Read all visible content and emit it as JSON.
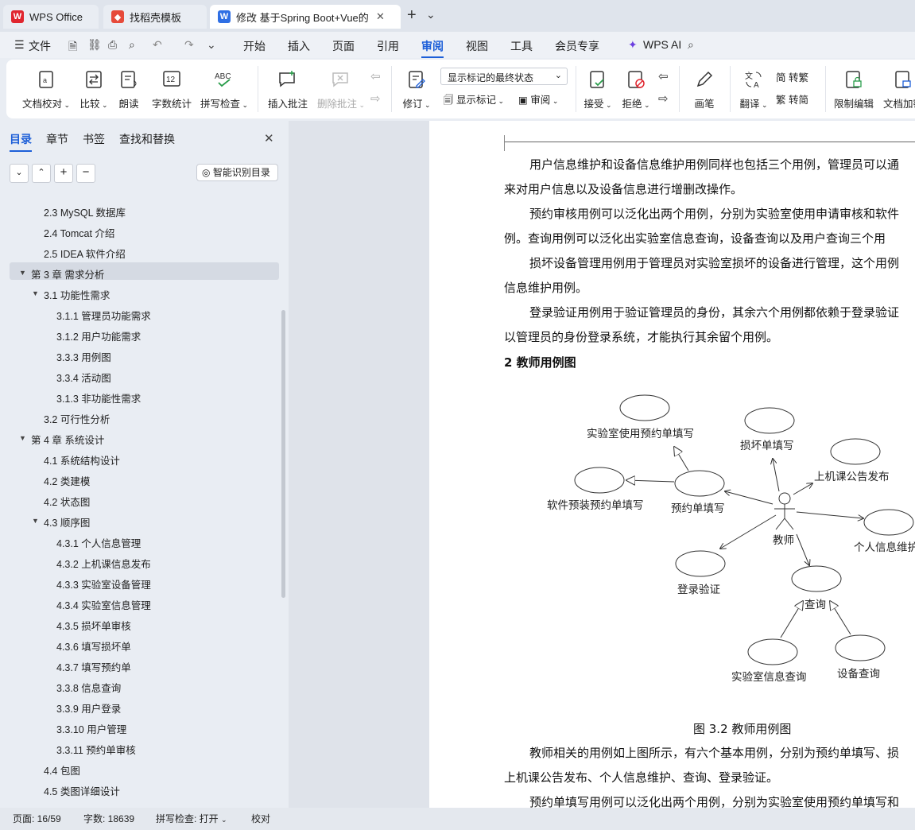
{
  "tabs": [
    {
      "label": "WPS Office"
    },
    {
      "label": "找稻壳模板"
    },
    {
      "label": "修改 基于Spring Boot+Vue的"
    }
  ],
  "tabbar": {
    "new_tab": "+",
    "dropdown": "⌄"
  },
  "menu": {
    "file": "文件",
    "items": [
      "开始",
      "插入",
      "页面",
      "引用",
      "审阅",
      "视图",
      "工具",
      "会员专享"
    ],
    "wps_ai": "WPS AI"
  },
  "ribbon": {
    "doc_proofread": "文档校对",
    "compare": "比较",
    "read_aloud": "朗读",
    "word_count": "字数统计",
    "spell_check": "拼写检查",
    "insert_comment": "插入批注",
    "delete_comment": "删除批注",
    "revise": "修订",
    "markup_select": "显示标记的最终状态",
    "show_markup": "显示标记",
    "review": "审阅",
    "accept": "接受",
    "reject": "拒绝",
    "brush": "画笔",
    "translate": "翻译",
    "to_traditional": "转繁",
    "to_simplified": "转简",
    "restrict_edit": "限制编辑",
    "doc_encrypt": "文档加密"
  },
  "panel": {
    "tabs": [
      "目录",
      "章节",
      "书签",
      "查找和替换"
    ],
    "smart_toc": "智能识别目录",
    "toc": [
      "2.3 MySQL 数据库",
      "2.4 Tomcat 介绍",
      "2.5 IDEA 软件介绍",
      "第 3 章  需求分析",
      "3.1  功能性需求",
      "3.1.1  管理员功能需求",
      "3.1.2  用户功能需求",
      "3.3.3 用例图",
      "3.3.4 活动图",
      "3.1.3  非功能性需求",
      "3.2  可行性分析",
      "第 4 章  系统设计",
      "4.1  系统结构设计",
      "4.2  类建模",
      "4.2  状态图",
      "4.3  顺序图",
      "4.3.1  个人信息管理",
      "4.3.2 上机课信息发布",
      "4.3.3 实验室设备管理",
      "4.3.4 实验室信息管理",
      "4.3.5 损坏单审核",
      "4.3.6 填写损坏单",
      "4.3.7 填写预约单",
      "3.3.8 信息查询",
      "3.3.9 用户登录",
      "3.3.10 用户管理",
      "3.3.11 预约单审核",
      "4.4  包图",
      "4.5 类图详细设计"
    ]
  },
  "document": {
    "paragraphs": [
      "用户信息维护和设备信息维护用例同样也包括三个用例，管理员可以通",
      "来对用户信息以及设备信息进行增删改操作。",
      "预约审核用例可以泛化出两个用例，分别为实验室使用申请审核和软件",
      "例。查询用例可以泛化出实验室信息查询，设备查询以及用户查询三个用",
      "损坏设备管理用例用于管理员对实验室损坏的设备进行管理，这个用例",
      "信息维护用例。",
      "登录验证用例用于验证管理员的身份，其余六个用例都依赖于登录验证",
      "以管理员的身份登录系统，才能执行其余留个用例。"
    ],
    "heading": "2  教师用例图",
    "diagram": {
      "labels": [
        "实验室使用预约单填写",
        "损坏单填写",
        "上机课公告发布",
        "软件预装预约单填写",
        "预约单填写",
        "个人信息维护",
        "教师",
        "登录验证",
        "查询",
        "实验室信息查询",
        "设备查询"
      ]
    },
    "caption": "图 3.2  教师用例图",
    "after": [
      "教师相关的用例如上图所示，有六个基本用例，分别为预约单填写、损",
      "上机课公告发布、个人信息维护、查询、登录验证。",
      "预约单填写用例可以泛化出两个用例，分别为实验室使用预约单填写和"
    ]
  },
  "status": {
    "page": "页面: 16/59",
    "words": "字数: 18639",
    "spell": "拼写检查: 打开",
    "proof": "校对"
  }
}
